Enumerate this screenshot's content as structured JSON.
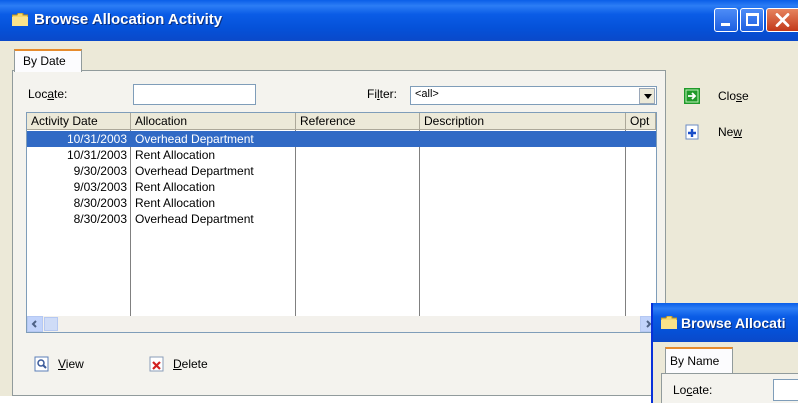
{
  "window": {
    "title": "Browse Allocation Activity"
  },
  "tab": {
    "label": "By Date"
  },
  "locate": {
    "label_pre": "Loc",
    "label_u": "a",
    "label_post": "te:",
    "value": ""
  },
  "filter": {
    "label_pre": "Fi",
    "label_u": "l",
    "label_post": "ter:",
    "value": "<all>"
  },
  "columns": [
    "Activity Date",
    "Allocation",
    "Reference",
    "Description",
    "Opt"
  ],
  "rows": [
    {
      "date": "10/31/2003",
      "allocation": "Overhead Department",
      "reference": "",
      "description": ""
    },
    {
      "date": "10/31/2003",
      "allocation": "Rent Allocation",
      "reference": "",
      "description": ""
    },
    {
      "date": "9/30/2003",
      "allocation": "Overhead Department",
      "reference": "",
      "description": ""
    },
    {
      "date": "9/03/2003",
      "allocation": "Rent Allocation",
      "reference": "",
      "description": ""
    },
    {
      "date": "8/30/2003",
      "allocation": "Rent Allocation",
      "reference": "",
      "description": ""
    },
    {
      "date": "8/30/2003",
      "allocation": "Overhead Department",
      "reference": "",
      "description": ""
    }
  ],
  "selected_row": 0,
  "buttons": {
    "close": {
      "pre": "Clo",
      "u": "s",
      "post": "e",
      "icon": "exit-icon"
    },
    "new": {
      "pre": "Ne",
      "u": "w",
      "post": "",
      "icon": "add-icon"
    },
    "view": {
      "pre": "",
      "u": "V",
      "post": "iew",
      "icon": "view-icon"
    },
    "delete": {
      "pre": "",
      "u": "D",
      "post": "elete",
      "icon": "delete-icon"
    }
  },
  "second_window": {
    "title": "Browse Allocati",
    "tab": "By Name",
    "locate_pre": "Lo",
    "locate_u": "c",
    "locate_post": "ate:"
  },
  "colors": {
    "titlebar": "#0a5ce6",
    "selection": "#316ac5",
    "tab_highlight": "#e68b2c"
  }
}
